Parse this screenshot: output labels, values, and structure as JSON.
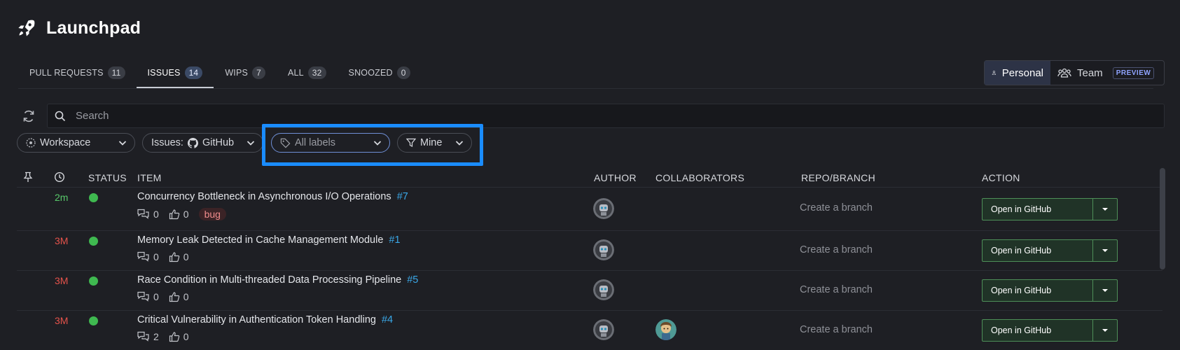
{
  "app": {
    "title": "Launchpad",
    "icon": "rocket-icon"
  },
  "tabs": [
    {
      "label": "PULL REQUESTS",
      "count": "11"
    },
    {
      "label": "ISSUES",
      "count": "14"
    },
    {
      "label": "WIPS",
      "count": "7"
    },
    {
      "label": "ALL",
      "count": "32"
    },
    {
      "label": "SNOOZED",
      "count": "0"
    }
  ],
  "scope": {
    "personal": "Personal",
    "team": "Team",
    "badge": "PREVIEW"
  },
  "search": {
    "placeholder": "Search",
    "value": ""
  },
  "filters": {
    "workspace": "Workspace",
    "issues": "Issues:",
    "issues_source": "GitHub",
    "labels": "All labels",
    "mine": "Mine"
  },
  "columns": {
    "status": "STATUS",
    "item": "ITEM",
    "author": "AUTHOR",
    "collaborators": "COLLABORATORS",
    "repo": "REPO/BRANCH",
    "action": "ACTION"
  },
  "rows": [
    {
      "age": "2m",
      "title": "Concurrency Bottleneck in Asynchronous I/O Operations",
      "number": "#7",
      "comments": "0",
      "reactions": "0",
      "label": "bug",
      "branch": "Create a branch",
      "action": "Open in GitHub"
    },
    {
      "age": "3M",
      "title": "Memory Leak Detected in Cache Management Module",
      "number": "#1",
      "comments": "0",
      "reactions": "0",
      "branch": "Create a branch",
      "action": "Open in GitHub"
    },
    {
      "age": "3M",
      "title": "Race Condition in Multi-threaded Data Processing Pipeline",
      "number": "#5",
      "comments": "0",
      "reactions": "0",
      "branch": "Create a branch",
      "action": "Open in GitHub"
    },
    {
      "age": "3M",
      "title": "Critical Vulnerability in Authentication Token Handling",
      "number": "#4",
      "comments": "2",
      "reactions": "0",
      "branch": "Create a branch",
      "action": "Open in GitHub"
    }
  ],
  "colors": {
    "accent": "#1a8cff",
    "status_open": "#3fb950",
    "age_new": "#58c86a",
    "age_old": "#e5534b",
    "link": "#3aa8e8"
  }
}
